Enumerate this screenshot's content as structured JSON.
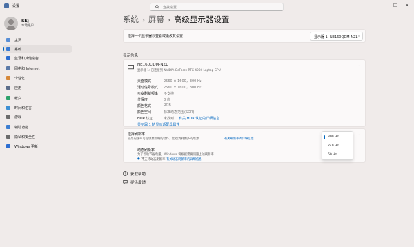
{
  "window": {
    "title": "设置",
    "minimize": "—",
    "maximize": "☐",
    "close": "✕"
  },
  "search": {
    "placeholder": "查找设置"
  },
  "user": {
    "name": "kkj",
    "subtitle": "本地帐户"
  },
  "sidebar": {
    "items": [
      {
        "label": "主页",
        "icon": "home-icon",
        "color": "#5a8fd6"
      },
      {
        "label": "系统",
        "icon": "system-icon",
        "color": "#3b7bd4",
        "active": true
      },
      {
        "label": "蓝牙和其他设备",
        "icon": "bluetooth-icon",
        "color": "#2d6ed1"
      },
      {
        "label": "网络和 Internet",
        "icon": "network-icon",
        "color": "#5c7aa8"
      },
      {
        "label": "个性化",
        "icon": "brush-icon",
        "color": "#d6883a"
      },
      {
        "label": "应用",
        "icon": "apps-icon",
        "color": "#5b6d8a"
      },
      {
        "label": "帐户",
        "icon": "account-icon",
        "color": "#2ea26b"
      },
      {
        "label": "时间和语言",
        "icon": "time-icon",
        "color": "#3d8fd4"
      },
      {
        "label": "游戏",
        "icon": "game-icon",
        "color": "#6b6b6b"
      },
      {
        "label": "辅助功能",
        "icon": "accessibility-icon",
        "color": "#3d7ed1"
      },
      {
        "label": "隐私和安全性",
        "icon": "shield-icon",
        "color": "#6b6b6b"
      },
      {
        "label": "Windows 更新",
        "icon": "update-icon",
        "color": "#2d6ed1"
      }
    ]
  },
  "breadcrumb": {
    "part1": "系统",
    "sep": "›",
    "part2": "屏幕",
    "current": "高级显示器设置"
  },
  "select_display": {
    "label": "选择一个显示器以查看或更改其设置",
    "value": "显示器 1: NE160QDM-NZL",
    "chevron": "⌄"
  },
  "section_title": "显示信息",
  "display": {
    "name": "NE160QDM-NZL",
    "sub": "显示器 1: 已连接到 NVIDIA GeForce RTX 4060 Laptop GPU",
    "collapse": "⌃",
    "rows": [
      {
        "label": "桌面模式",
        "value": "2560 × 1600，300 Hz"
      },
      {
        "label": "活动信号模式",
        "value": "2560 × 1600，300 Hz"
      },
      {
        "label": "可变刷新频率",
        "value": "不支持"
      },
      {
        "label": "位深度",
        "value": "8 位"
      },
      {
        "label": "颜色格式",
        "value": "RGB"
      },
      {
        "label": "颜色空间",
        "value": "标准动态范围(SDR)"
      },
      {
        "label": "HDR 认证",
        "value": "未找到",
        "link": "有关 HDR 认证的详细信息"
      }
    ],
    "adapter_link": "显示器 1 的显示适配器属性"
  },
  "refresh": {
    "title": "选择刷新率",
    "desc": "较高的速率可提供更流畅的动作，但也消耗更多的电源",
    "desc_link": "有关刷新率的详细信息",
    "collapse": "⌃",
    "options": [
      "300 Hz",
      "240 Hz",
      "60 Hz"
    ],
    "dynamic_title": "动态刷新率",
    "dynamic_desc": "为了帮助节省电量，Windows 将根据需要调整上述刷新率",
    "dynamic_note": "不支持动态刷新率",
    "dynamic_link": "有关动态刷新率的详细信息"
  },
  "help": {
    "get_help": "获取帮助",
    "feedback": "提供反馈"
  },
  "colors": {
    "accent": "#0067c0"
  }
}
